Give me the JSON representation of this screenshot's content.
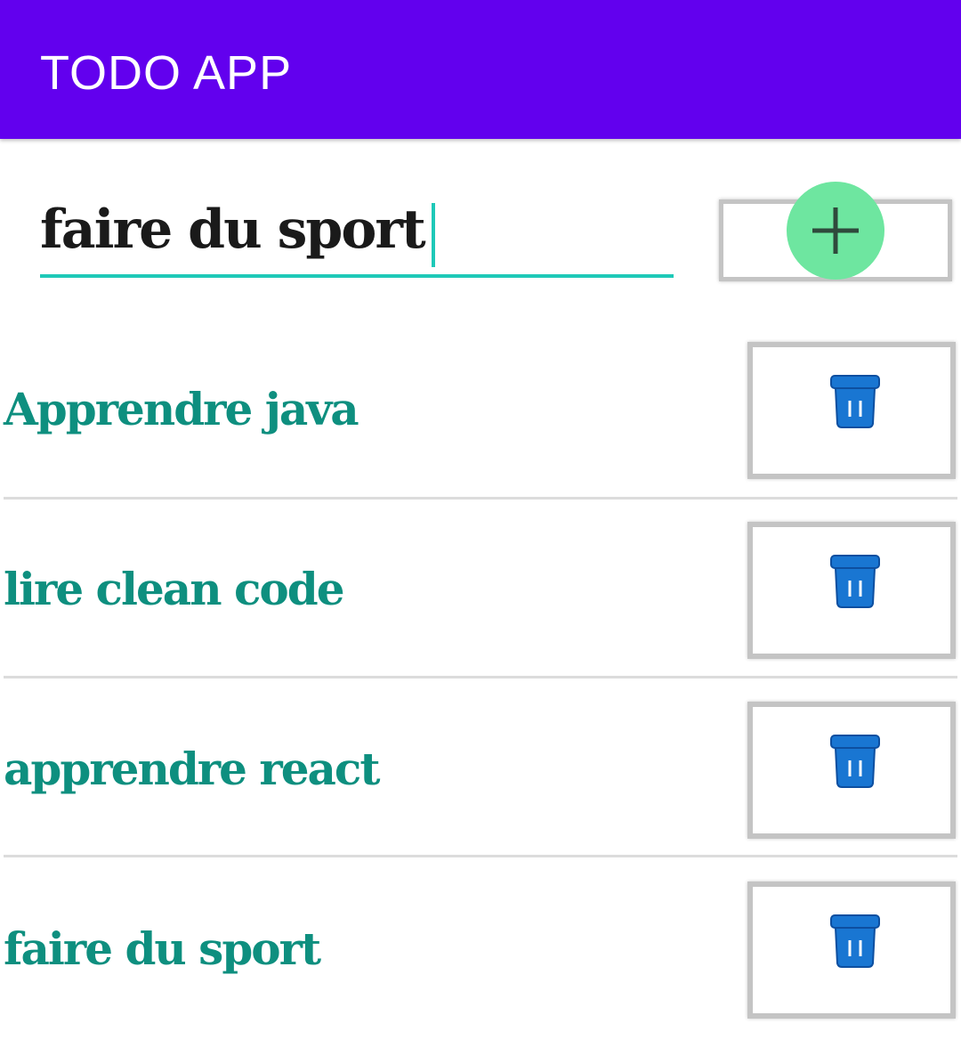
{
  "app_bar": {
    "title": "TODO APP",
    "background_color": "#6200EE"
  },
  "new_task": {
    "value": "faire du sport",
    "underline_color": "#1ec9b8",
    "add_icon": "plus-icon",
    "fab_color": "#6ee6a0"
  },
  "tasks": [
    {
      "label": "Apprendre java",
      "delete_icon": "trash-icon"
    },
    {
      "label": "lire clean code",
      "delete_icon": "trash-icon"
    },
    {
      "label": "apprendre react",
      "delete_icon": "trash-icon"
    },
    {
      "label": "faire du sport",
      "delete_icon": "trash-icon"
    }
  ],
  "colors": {
    "task_text": "#0e8f7f",
    "trash_icon": "#1976D2"
  }
}
